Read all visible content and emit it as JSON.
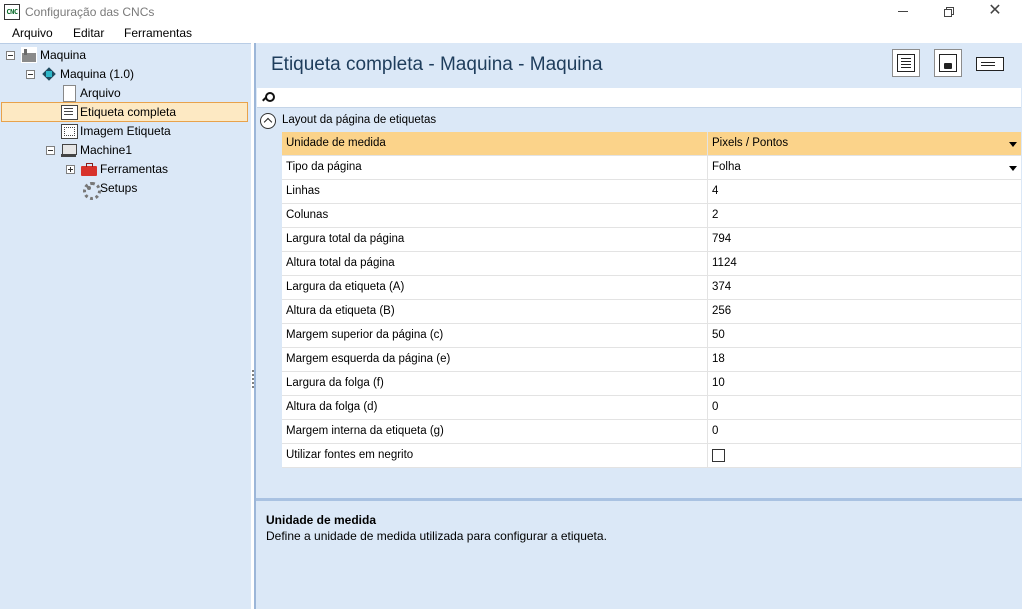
{
  "window": {
    "title": "Configuração das CNCs",
    "app_icon_text": "CNC"
  },
  "menu": {
    "items": [
      "Arquivo",
      "Editar",
      "Ferramentas"
    ]
  },
  "tree": {
    "nodes": [
      {
        "label": "Maquina",
        "icon": "factory-icon",
        "expander": "minus"
      },
      {
        "label": "Maquina (1.0)",
        "icon": "cube-icon",
        "expander": "minus"
      },
      {
        "label": "Arquivo",
        "icon": "document-icon"
      },
      {
        "label": "Etiqueta completa",
        "icon": "label-icon",
        "selected": true
      },
      {
        "label": "Imagem Etiqueta",
        "icon": "image-label-icon"
      },
      {
        "label": "Machine1",
        "icon": "machine-icon",
        "expander": "minus"
      },
      {
        "label": "Ferramentas",
        "icon": "toolbox-icon",
        "expander": "plus"
      },
      {
        "label": "Setups",
        "icon": "gear-icon"
      }
    ]
  },
  "main": {
    "title": "Etiqueta completa - Maquina - Maquina",
    "toolbar_icons": [
      "full-label-view-icon",
      "image-label-view-icon",
      "text-label-view-icon"
    ],
    "search": {
      "value": "",
      "placeholder": ""
    },
    "category": "Layout da página de etiquetas",
    "properties": [
      {
        "name": "Unidade de medida",
        "value": "Pixels / Pontos",
        "dropdown": true,
        "selected": true
      },
      {
        "name": "Tipo da página",
        "value": "Folha",
        "dropdown": true
      },
      {
        "name": "Linhas",
        "value": "4"
      },
      {
        "name": "Colunas",
        "value": "2"
      },
      {
        "name": "Largura total da página",
        "value": "794"
      },
      {
        "name": "Altura total da página",
        "value": "1124"
      },
      {
        "name": "Largura da etiqueta (A)",
        "value": "374"
      },
      {
        "name": "Altura da etiqueta (B)",
        "value": "256"
      },
      {
        "name": "Margem superior da página (c)",
        "value": "50"
      },
      {
        "name": "Margem esquerda da página (e)",
        "value": "18"
      },
      {
        "name": "Largura da folga (f)",
        "value": "10"
      },
      {
        "name": "Altura da folga (d)",
        "value": "0"
      },
      {
        "name": "Margem interna da etiqueta (g)",
        "value": "0"
      },
      {
        "name": "Utilizar fontes em negrito",
        "value": "",
        "checkbox": true,
        "checked": false
      }
    ],
    "help": {
      "title": "Unidade de medida",
      "text": "Define a unidade de medida utilizada para configurar a etiqueta."
    }
  },
  "colors": {
    "panel_bg": "#dbe8f7",
    "selection": "#fbd38a",
    "tree_selection_border": "#e8a24b",
    "title_text": "#1e3d5c"
  }
}
